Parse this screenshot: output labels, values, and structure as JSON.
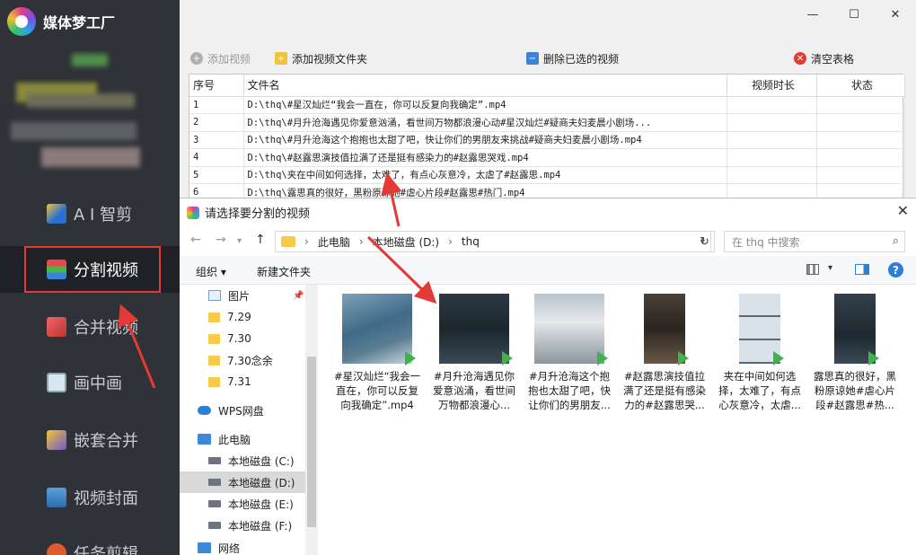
{
  "app": {
    "title": "媒体梦工厂"
  },
  "sidebar": {
    "items": [
      {
        "label": "A I 智剪"
      },
      {
        "label": "分割视频"
      },
      {
        "label": "合并视频"
      },
      {
        "label": "画中画"
      },
      {
        "label": "嵌套合并"
      },
      {
        "label": "视频封面"
      },
      {
        "label": "任务剪辑"
      }
    ]
  },
  "window": {
    "minimize": "—",
    "maximize": "☐",
    "close": "✕"
  },
  "toolbar": {
    "add_video": "添加视频",
    "add_folder": "添加视频文件夹",
    "delete_selected": "删除已选的视频",
    "clear_table": "清空表格"
  },
  "table": {
    "headers": {
      "index": "序号",
      "filename": "文件名",
      "duration": "视频时长",
      "status": "状态"
    },
    "rows": [
      {
        "index": "1",
        "filename": "D:\\thq\\#星汉灿烂“我会一直在，你可以反复向我确定”.mp4"
      },
      {
        "index": "2",
        "filename": "D:\\thq\\#月升沧海遇见你爱意汹涌，看世间万物都浪漫心动#星汉灿烂#疑商夫妇麦晨小剧场..."
      },
      {
        "index": "3",
        "filename": "D:\\thq\\#月升沧海这个抱抱也太甜了吧，快让你们的男朋友来挑战#疑商夫妇麦晨小剧场.mp4"
      },
      {
        "index": "4",
        "filename": "D:\\thq\\#赵露思演技值拉满了还是挺有感染力的#赵露思哭戏.mp4"
      },
      {
        "index": "5",
        "filename": "D:\\thq\\夹在中间如何选择，太难了，有点心灰意冷，太虐了#赵露思.mp4"
      },
      {
        "index": "6",
        "filename": "D:\\thq\\露思真的很好，黑粉原谅她#虐心片段#赵露思#热门.mp4"
      }
    ]
  },
  "dialog": {
    "title": "请选择要分割的视频",
    "close": "✕",
    "path": {
      "root": "此电脑",
      "drive": "本地磁盘 (D:)",
      "folder": "thq"
    },
    "search_placeholder": "在 thq 中搜索",
    "organize": "组织 ▾",
    "new_folder": "新建文件夹",
    "help": "?",
    "tree": [
      {
        "label": "图片"
      },
      {
        "label": "7.29"
      },
      {
        "label": "7.30"
      },
      {
        "label": "7.30念余"
      },
      {
        "label": "7.31"
      },
      {
        "label": "WPS网盘"
      },
      {
        "label": "此电脑"
      },
      {
        "label": "本地磁盘 (C:)"
      },
      {
        "label": "本地磁盘 (D:)"
      },
      {
        "label": "本地磁盘 (E:)"
      },
      {
        "label": "本地磁盘 (F:)"
      },
      {
        "label": "网络"
      }
    ],
    "files": [
      {
        "label": "#星汉灿烂“我会一直在，你可以反复向我确定”.mp4"
      },
      {
        "label": "#月升沧海遇见你爱意汹涌，看世间万物都浪漫心..."
      },
      {
        "label": "#月升沧海这个抱抱也太甜了吧，快让你们的男朋友..."
      },
      {
        "label": "#赵露思演技值拉满了还是挺有感染力的#赵露思哭..."
      },
      {
        "label": "夹在中间如何选择，太难了，有点心灰意冷，太虐..."
      },
      {
        "label": "露思真的很好，黑粉原谅她#虐心片段#赵露思#热..."
      }
    ]
  },
  "colors": {
    "sidebar_bg": "#2f3237",
    "highlight": "#e53935",
    "accent": "#2b7fd6"
  }
}
